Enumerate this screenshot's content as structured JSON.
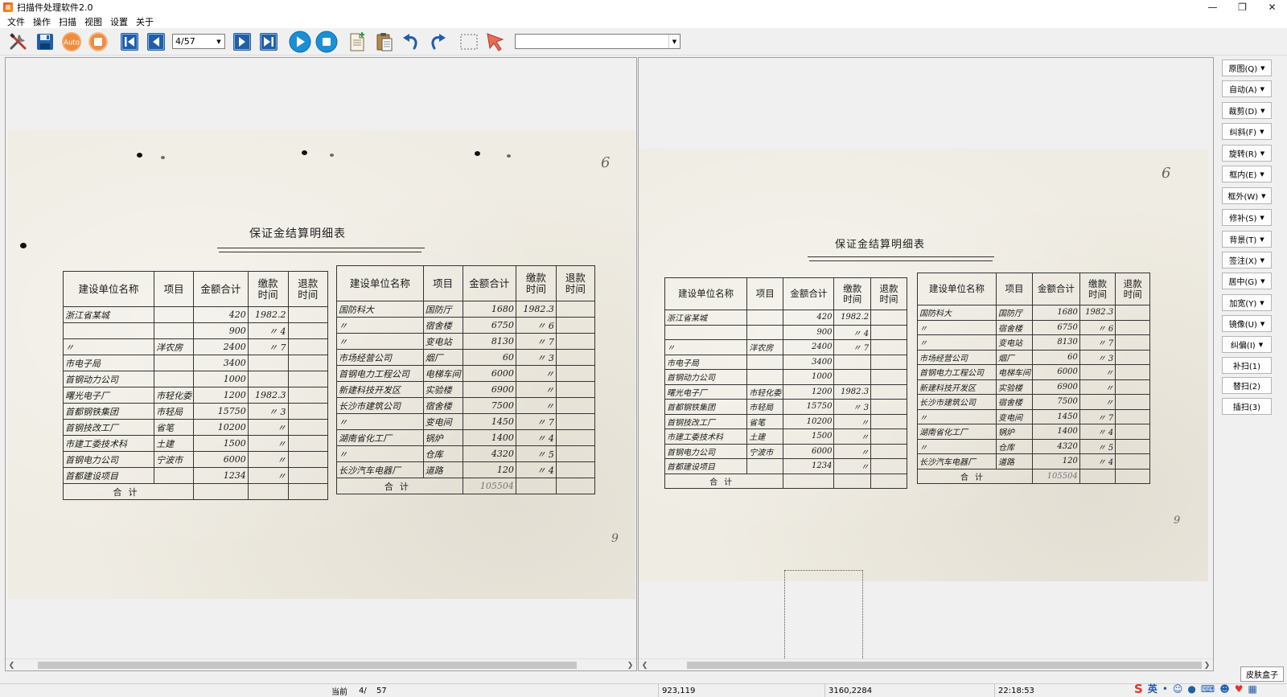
{
  "window": {
    "title": "扫描件处理软件2.0"
  },
  "menu": [
    "文件",
    "操作",
    "扫描",
    "视图",
    "设置",
    "关于"
  ],
  "toolbar": {
    "page_value": "4/57",
    "auto_label": "Auto",
    "mode_value": ""
  },
  "sheet": {
    "title": "保证金结算明细表",
    "page_mark": "6",
    "corner_mark": "9",
    "left_headers": [
      "建设单位名称",
      "项目",
      "金额合计",
      "缴款\n时间",
      "退款\n时间"
    ],
    "left_rows": [
      [
        "浙江省某城",
        "",
        "420",
        "1982.2",
        ""
      ],
      [
        "",
        "",
        "900",
        "〃 4",
        ""
      ],
      [
        "〃",
        "洋农房",
        "2400",
        "〃 7",
        ""
      ],
      [
        "市电子局",
        "",
        "3400",
        "",
        ""
      ],
      [
        "首钢动力公司",
        "",
        "1000",
        "",
        ""
      ],
      [
        "曙光电子厂",
        "市轻化委",
        "1200",
        "1982.3",
        ""
      ],
      [
        "首都钢铁集团",
        "市轻局",
        "15750",
        "〃 3",
        ""
      ],
      [
        "首钢技改工厂",
        "省笔",
        "10200",
        "〃",
        ""
      ],
      [
        "市建工委技术科",
        "土建",
        "1500",
        "〃",
        ""
      ],
      [
        "首钢电力公司",
        "宁波市",
        "6000",
        "〃",
        ""
      ],
      [
        "首都建设项目",
        "",
        "1234",
        "〃",
        ""
      ]
    ],
    "left_total": "合计",
    "right_headers": [
      "建设单位名称",
      "项目",
      "金额合计",
      "缴款\n时间",
      "退款\n时间"
    ],
    "right_rows": [
      [
        "国防科大",
        "国防厅",
        "1680",
        "1982.3",
        ""
      ],
      [
        "〃",
        "宿舍楼",
        "6750",
        "〃 6",
        ""
      ],
      [
        "〃",
        "变电站",
        "8130",
        "〃 7",
        ""
      ],
      [
        "市场经营公司",
        "烟厂",
        "60",
        "〃 3",
        ""
      ],
      [
        "首钢电力工程公司",
        "电梯车间",
        "6000",
        "〃",
        ""
      ],
      [
        "新建科技开发区",
        "实验楼",
        "6900",
        "〃",
        ""
      ],
      [
        "长沙市建筑公司",
        "宿舍楼",
        "7500",
        "〃",
        ""
      ],
      [
        "〃",
        "变电间",
        "1450",
        "〃 7",
        ""
      ],
      [
        "湖南省化工厂",
        "锅炉",
        "1400",
        "〃 4",
        ""
      ],
      [
        "〃",
        "仓库",
        "4320",
        "〃 5",
        ""
      ],
      [
        "长沙汽车电器厂",
        "道路",
        "120",
        "〃 4",
        ""
      ]
    ],
    "right_total": "合计",
    "right_total_sum": "105504"
  },
  "side_buttons": [
    {
      "label": "原图(Q)",
      "dd": true
    },
    {
      "label": "自动(A)",
      "dd": true
    },
    {
      "label": "裁剪(D)",
      "dd": true
    },
    {
      "label": "纠斜(F)",
      "dd": true
    },
    {
      "label": "旋转(R)",
      "dd": true
    },
    {
      "label": "框内(E)",
      "dd": true
    },
    {
      "label": "框外(W)",
      "dd": true
    },
    {
      "label": "修补(S)",
      "dd": true
    },
    {
      "label": "背景(T)",
      "dd": true
    },
    {
      "label": "签注(X)",
      "dd": true
    },
    {
      "label": "居中(G)",
      "dd": true
    },
    {
      "label": "加宽(Y)",
      "dd": true
    },
    {
      "label": "镜像(U)",
      "dd": true
    },
    {
      "label": "纠偏(I)",
      "dd": true
    },
    {
      "label": "补扫(1)",
      "dd": false
    },
    {
      "label": "替扫(2)",
      "dd": false
    },
    {
      "label": "插扫(3)",
      "dd": false
    }
  ],
  "skin_button": "皮肤盒子",
  "status": {
    "current_label": "当前",
    "current_page": "4/",
    "total_pages": "57",
    "cursor": "923,119",
    "image_size": "3160,2284",
    "time": "22:18:53"
  },
  "tray": {
    "ime_logo": "S",
    "ime_lang": "英"
  },
  "colors": {
    "play_blue": "#1b8fd6",
    "nav_blue": "#1f5fa8",
    "paper": "#efece3",
    "accent_orange": "#f08c3c"
  }
}
